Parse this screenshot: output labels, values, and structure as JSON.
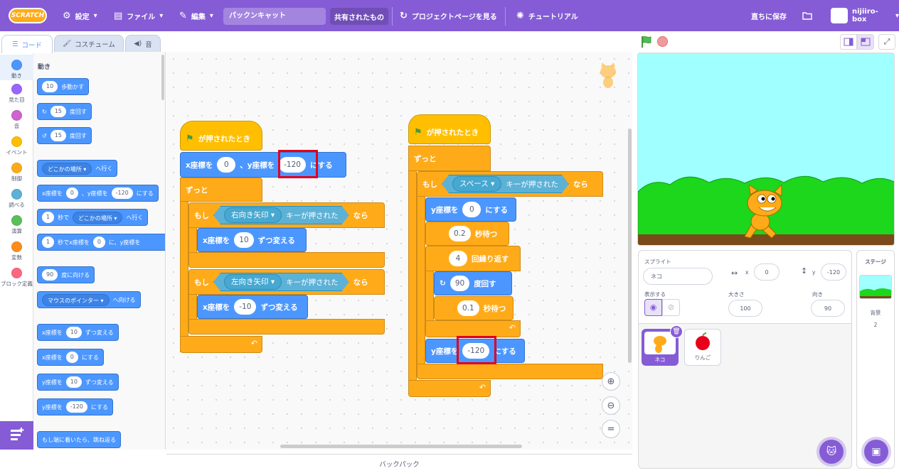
{
  "menubar": {
    "logo": "SCRATCH",
    "settings": "設定",
    "file": "ファイル",
    "edit": "編集",
    "project_title": "パックンキャット",
    "share": "共有されたもの",
    "project_page": "プロジェクトページを見る",
    "tutorials": "チュートリアル",
    "save_now": "直ちに保存",
    "username": "nijiiro-box"
  },
  "tabs": {
    "code": "コード",
    "costume": "コスチューム",
    "sound": "音"
  },
  "categories": [
    {
      "label": "動き",
      "color": "#4c97ff"
    },
    {
      "label": "見た目",
      "color": "#9966ff"
    },
    {
      "label": "音",
      "color": "#cf63cf"
    },
    {
      "label": "イベント",
      "color": "#ffbf00"
    },
    {
      "label": "制御",
      "color": "#ffab19"
    },
    {
      "label": "調べる",
      "color": "#5cb1d6"
    },
    {
      "label": "演算",
      "color": "#59c059"
    },
    {
      "label": "変数",
      "color": "#ff8c1a"
    },
    {
      "label": "ブロック定義",
      "color": "#ff6680"
    }
  ],
  "palette": {
    "title": "動き",
    "move": {
      "val": "10",
      "text": "歩動かす"
    },
    "turn_right": {
      "val": "15",
      "text": "度回す"
    },
    "turn_left": {
      "val": "15",
      "text": "度回す"
    },
    "goto": {
      "dd": "どこかの場所",
      "text": "へ行く"
    },
    "gotoxy": {
      "a": "x座標を",
      "x": "0",
      "b": "、y座標を",
      "y": "-120",
      "c": "にする"
    },
    "glide": {
      "n": "1",
      "a": "秒で",
      "dd": "どこかの場所",
      "b": "へ行く"
    },
    "glidexy": {
      "n": "1",
      "a": "秒でx座標を",
      "x": "0",
      "b": "に、y座標を"
    },
    "point_dir": {
      "val": "90",
      "text": "度に向ける"
    },
    "point_towards": {
      "dd": "マウスのポインター",
      "text": "へ向ける"
    },
    "change_x": {
      "a": "x座標を",
      "val": "10",
      "b": "ずつ変える"
    },
    "set_x": {
      "a": "x座標を",
      "val": "0",
      "b": "にする"
    },
    "change_y": {
      "a": "y座標を",
      "val": "10",
      "b": "ずつ変える"
    },
    "set_y": {
      "a": "y座標を",
      "val": "-120",
      "b": "にする"
    },
    "bounce": "もし端に着いたら、跳ね返る"
  },
  "script1": {
    "hat": "が押されたとき",
    "gotoxy": {
      "a": "x座標を",
      "x": "0",
      "b": "、y座標を",
      "y": "-120",
      "c": "にする"
    },
    "forever": "ずっと",
    "if1": {
      "a": "もし",
      "key": "右向き矢印",
      "b": "キーが押された",
      "c": "なら"
    },
    "change1": {
      "a": "x座標を",
      "val": "10",
      "b": "ずつ変える"
    },
    "if2": {
      "a": "もし",
      "key": "左向き矢印",
      "b": "キーが押された",
      "c": "なら"
    },
    "change2": {
      "a": "x座標を",
      "val": "-10",
      "b": "ずつ変える"
    }
  },
  "script2": {
    "hat": "が押されたとき",
    "forever": "ずっと",
    "if": {
      "a": "もし",
      "key": "スペース",
      "b": "キーが押された",
      "c": "なら"
    },
    "sety1": {
      "a": "y座標を",
      "val": "0",
      "b": "にする"
    },
    "wait1": {
      "val": "0.2",
      "text": "秒待つ"
    },
    "repeat": {
      "val": "4",
      "text": "回繰り返す"
    },
    "turn": {
      "val": "90",
      "text": "度回す"
    },
    "wait2": {
      "val": "0.1",
      "text": "秒待つ"
    },
    "sety2": {
      "a": "y座標を",
      "val": "-120",
      "b": "にする"
    }
  },
  "backpack": "バックパック",
  "sprite_info": {
    "sprite_label": "スプライト",
    "name": "ネコ",
    "x_label": "x",
    "x": "0",
    "y_label": "y",
    "y": "-120",
    "show_label": "表示する",
    "size_label": "大きさ",
    "size": "100",
    "direction_label": "向き",
    "direction": "90"
  },
  "sprites": [
    {
      "name": "ネコ"
    },
    {
      "name": "りんご"
    }
  ],
  "stage_pane": {
    "title": "ステージ",
    "backdrop_label": "背景",
    "backdrop_count": "2"
  },
  "colors": {
    "accent": "#855cd6",
    "motion": "#4c97ff",
    "events": "#ffbf00",
    "control": "#ffab19",
    "sensing": "#5cb1d6",
    "highlight": "#e0001b"
  }
}
